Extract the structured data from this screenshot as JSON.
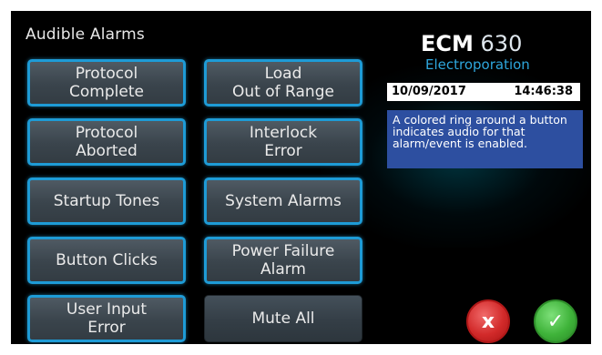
{
  "title": "Audible Alarms",
  "brand": {
    "name_bold": "ECM",
    "name_light": "630",
    "subtitle": "Electroporation"
  },
  "datetime": {
    "date": "10/09/2017",
    "time": "14:46:38"
  },
  "info_text": "A colored ring around a button indicates audio for that alarm/event is enabled.",
  "buttons": {
    "protocol_complete": {
      "label": "Protocol\nComplete",
      "enabled": true
    },
    "load_out_of_range": {
      "label": "Load\nOut of Range",
      "enabled": true
    },
    "protocol_aborted": {
      "label": "Protocol\nAborted",
      "enabled": true
    },
    "interlock_error": {
      "label": "Interlock\nError",
      "enabled": true
    },
    "startup_tones": {
      "label": "Startup Tones",
      "enabled": true
    },
    "system_alarms": {
      "label": "System Alarms",
      "enabled": true
    },
    "button_clicks": {
      "label": "Button Clicks",
      "enabled": true
    },
    "power_failure_alarm": {
      "label": "Power Failure\nAlarm",
      "enabled": true
    },
    "user_input_error": {
      "label": "User Input\nError",
      "enabled": true
    },
    "mute_all": {
      "label": "Mute All",
      "enabled": false
    }
  },
  "actions": {
    "cancel_symbol": "x",
    "confirm_symbol": "✓"
  },
  "colors": {
    "ring": "#1e9bd6",
    "brand_sub": "#2ea6dc",
    "info_bg": "#2d4fa0",
    "cancel": "#d22a2a",
    "confirm": "#3fb33a"
  }
}
